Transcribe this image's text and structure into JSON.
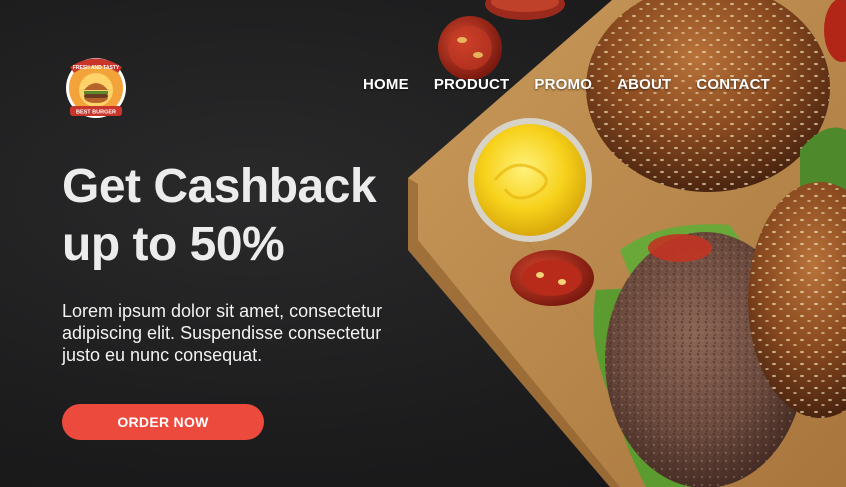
{
  "brand": {
    "logo_top_text": "FRESH AND TASTY",
    "logo_bottom_text": "BEST BURGER"
  },
  "nav": {
    "items": [
      "HOME",
      "PRODUCT",
      "PROMO",
      "ABOUT",
      "CONTACT"
    ]
  },
  "hero": {
    "headline_line1": "Get Cashback",
    "headline_line2": "up to 50%",
    "description_line1": "Lorem ipsum dolor sit amet, consectetur",
    "description_line2": "adipiscing elit. Suspendisse consectetur",
    "description_line3": "justo eu nunc consequat.",
    "cta_label": "ORDER NOW"
  },
  "colors": {
    "background": "#1e1e1f",
    "accent": "#ec4a3c",
    "logo_gold": "#f2a33a",
    "logo_red": "#c8362b"
  }
}
